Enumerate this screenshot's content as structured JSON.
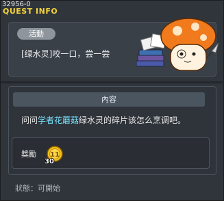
{
  "header": {
    "id": "32956-0",
    "title": "QUEST INFO"
  },
  "quest": {
    "badge": "活動",
    "title": "[绿水灵]咬一口，尝一尝"
  },
  "content": {
    "header": "內容",
    "desc_before": "问问",
    "desc_highlight": "学者花蘑菇",
    "desc_after": "绿水灵的碎片该怎么烹调吧。"
  },
  "reward": {
    "label": "獎勵",
    "coin_level": "11",
    "count": "30"
  },
  "status": "狀態：可開始",
  "colors": {
    "title": "#f4d23a",
    "highlight": "#78e3ff"
  }
}
